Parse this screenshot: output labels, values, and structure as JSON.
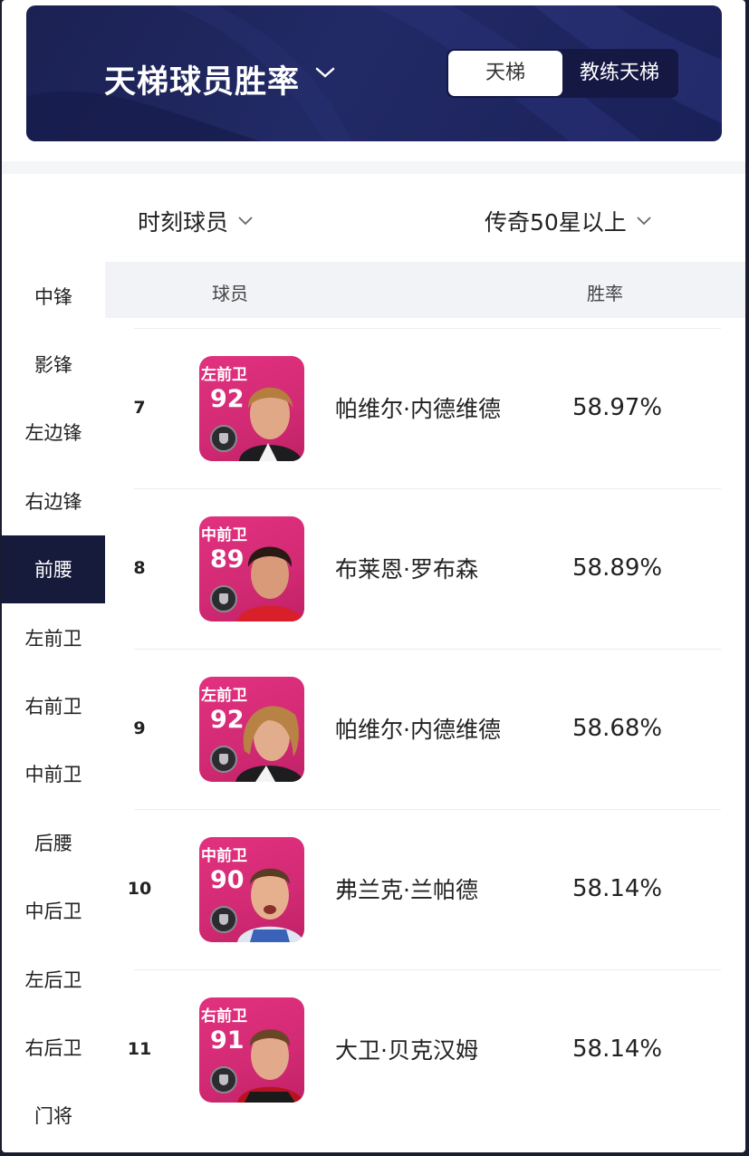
{
  "header": {
    "title": "天梯球员胜率",
    "tabs": [
      {
        "label": "天梯",
        "selected": true
      },
      {
        "label": "教练天梯",
        "selected": false
      }
    ]
  },
  "filters": {
    "player_type": "时刻球员",
    "tier": "传奇50星以上"
  },
  "sidebar": {
    "items": [
      {
        "label": "中锋"
      },
      {
        "label": "影锋"
      },
      {
        "label": "左边锋"
      },
      {
        "label": "右边锋"
      },
      {
        "label": "前腰",
        "active": true
      },
      {
        "label": "左前卫"
      },
      {
        "label": "右前卫"
      },
      {
        "label": "中前卫"
      },
      {
        "label": "后腰"
      },
      {
        "label": "中后卫"
      },
      {
        "label": "左后卫"
      },
      {
        "label": "右后卫"
      },
      {
        "label": "门将"
      }
    ]
  },
  "table": {
    "columns": [
      "球员",
      "胜率"
    ],
    "rows": [
      {
        "rank": "7",
        "position": "左前卫",
        "rating": "92",
        "name": "帕维尔·内德维德",
        "win_rate": "58.97%"
      },
      {
        "rank": "8",
        "position": "中前卫",
        "rating": "89",
        "name": "布莱恩·罗布森",
        "win_rate": "58.89%"
      },
      {
        "rank": "9",
        "position": "左前卫",
        "rating": "92",
        "name": "帕维尔·内德维德",
        "win_rate": "58.68%"
      },
      {
        "rank": "10",
        "position": "中前卫",
        "rating": "90",
        "name": "弗兰克·兰帕德",
        "win_rate": "58.14%"
      },
      {
        "rank": "11",
        "position": "右前卫",
        "rating": "91",
        "name": "大卫·贝克汉姆",
        "win_rate": "58.14%"
      }
    ]
  },
  "colors": {
    "banner": "#1f2660",
    "active_sidebar": "#161a3b",
    "card": "#d92c78"
  }
}
